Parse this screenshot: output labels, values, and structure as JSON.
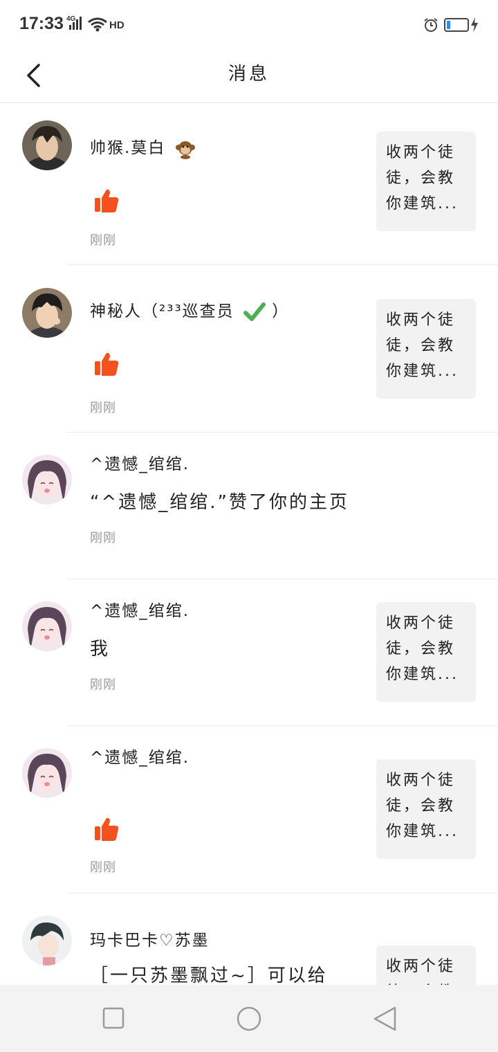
{
  "status_bar": {
    "time": "17:33",
    "network": "4G",
    "hd_label": "HD",
    "battery_color": "#2c8de8"
  },
  "header": {
    "title": "消息",
    "back_icon": "chevron-left-icon"
  },
  "colors": {
    "like": "#f4511e",
    "quote_bg": "#f2f2f2",
    "time_text": "#999999"
  },
  "messages": [
    {
      "name": "帅猴.莫白",
      "name_emoji": "monkey-icon",
      "type": "like",
      "time": "刚刚",
      "quote": "收两个徒徒，会教你建筑..."
    },
    {
      "name": "神秘人（²³³巡查员",
      "name_suffix": "）",
      "name_emoji": "check-icon",
      "type": "like",
      "time": "刚刚",
      "quote": "收两个徒徒，会教你建筑..."
    },
    {
      "name": "^遗憾_绾绾.",
      "type": "text",
      "content": "“^遗憾_绾绾.”赞了你的主页",
      "time": "刚刚"
    },
    {
      "name": "^遗憾_绾绾.",
      "type": "text",
      "content": "我",
      "time": "刚刚",
      "quote": "收两个徒徒，会教你建筑..."
    },
    {
      "name": "^遗憾_绾绾.",
      "type": "like",
      "time": "刚刚",
      "quote": "收两个徒徒，会教你建筑..."
    },
    {
      "name": "玛卡巴卡♡苏墨",
      "type": "text",
      "content": "［一只苏墨飘过~］可以给",
      "quote": "收两个徒徒，会教你建筑..."
    }
  ],
  "nav_bar": {
    "buttons": [
      "recent-apps-button",
      "home-button",
      "back-nav-button"
    ]
  }
}
